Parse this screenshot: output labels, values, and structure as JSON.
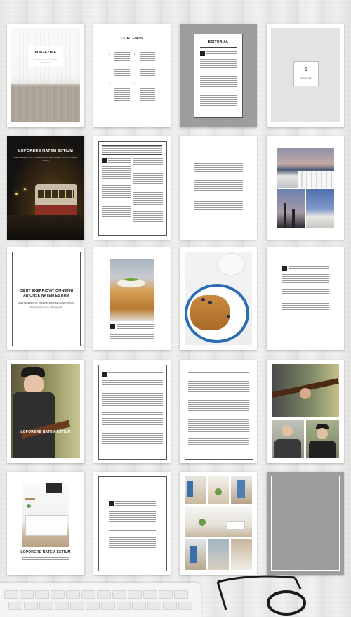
{
  "pages": {
    "cover": {
      "title": "MAGAZINE",
      "subtitle": "lorem ipsum dolor sit amet consectetur"
    },
    "contents": {
      "title": "CONTENTS",
      "numbers": [
        "1",
        "2",
        "3",
        "4"
      ]
    },
    "editorial": {
      "title": "EDITORIAL"
    },
    "section": {
      "number": "1",
      "label": "Section title"
    },
    "tram": {
      "title": "LOPORERE NATEM ESTIUM",
      "subtitle": "CIENT EXERRIOVIT OMNIMINI ARIONSE NATEM ESTIUM LOREM IPSUM"
    },
    "feature": {
      "title": "CIENT EXERRIOVIT OMNIMINI ARIONSE NATEM ESTIUM",
      "subtitle": "CIENT EXERRIOVIT OMNIMINI ARIONSE NATEM ESTIUM",
      "byline": "Text by Author Name | Photography"
    },
    "guitar": {
      "title": "LOPORERE NATEM ESTIUM"
    },
    "kitchen": {
      "title": "LOPORERE NATEM ESTIUM"
    }
  },
  "colors": {
    "wood": "#ebebe9",
    "gray_page": "#9d9d9b",
    "dark_page": "#1c1a18",
    "accent_blue": "#2a6db0"
  }
}
